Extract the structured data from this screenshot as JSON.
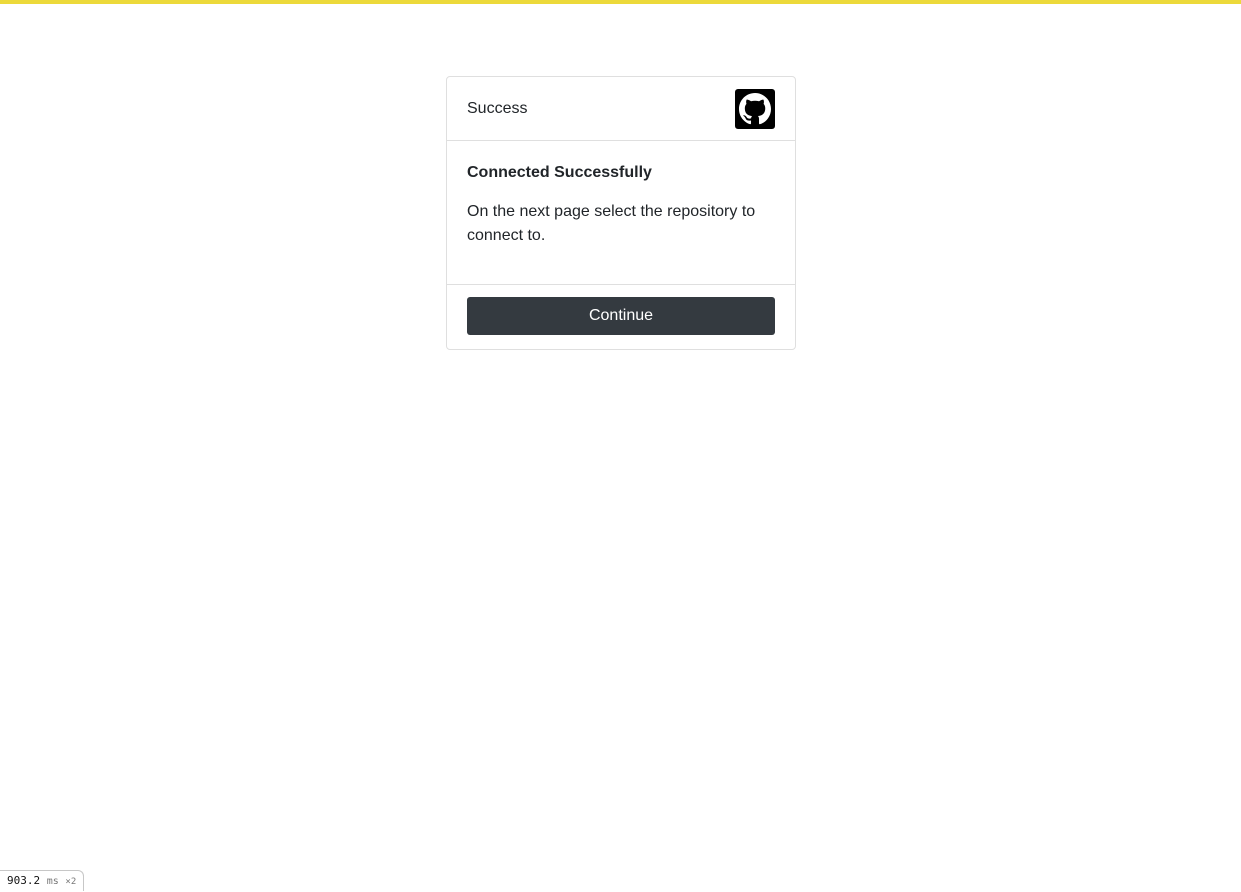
{
  "colors": {
    "accent_bar": "#ecd93a",
    "button_bg": "#343a40",
    "button_text": "#ffffff",
    "border": "#dfdfdf"
  },
  "card": {
    "header_title": "Success",
    "logo_icon": "github-icon",
    "heading": "Connected Successfully",
    "message": "On the next page select the repository to connect to.",
    "continue_label": "Continue"
  },
  "timing": {
    "value": "903.2",
    "unit": "ms",
    "multiplier": "×2"
  }
}
